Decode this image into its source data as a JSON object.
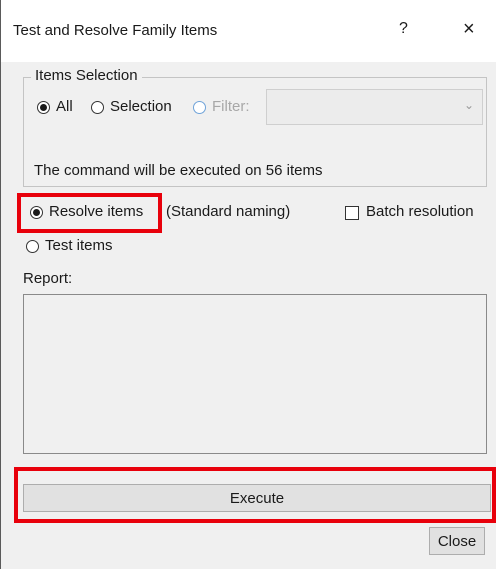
{
  "window": {
    "title": "Test and Resolve Family Items",
    "help_label": "?",
    "close_label": "×"
  },
  "items_selection": {
    "group_title": "Items Selection",
    "options": [
      {
        "label": "All",
        "checked": true,
        "enabled": true
      },
      {
        "label": "Selection",
        "checked": false,
        "enabled": true
      },
      {
        "label": "Filter:",
        "checked": false,
        "enabled": false
      }
    ],
    "filter_value": "",
    "status": "The command will be executed on 56 items"
  },
  "mode": {
    "resolve_label": "Resolve items",
    "resolve_checked": true,
    "naming_note": "(Standard naming)",
    "batch_label": "Batch resolution",
    "batch_checked": false,
    "test_label": "Test items",
    "test_checked": false
  },
  "report": {
    "label": "Report:",
    "content": ""
  },
  "buttons": {
    "execute_label": "Execute",
    "close_label": "Close"
  },
  "colors": {
    "highlight": "#e8000b",
    "dialog_bg": "#f0f0f0",
    "button_bg": "#e1e1e1"
  }
}
